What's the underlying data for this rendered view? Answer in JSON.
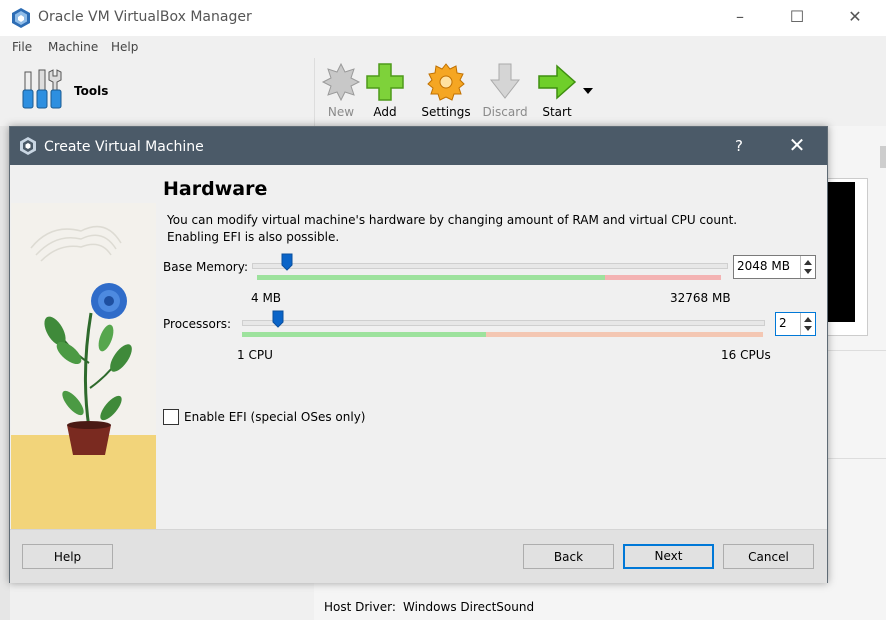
{
  "window": {
    "title": "Oracle VM VirtualBox Manager"
  },
  "menu": [
    "File",
    "Machine",
    "Help"
  ],
  "tools": {
    "label": "Tools"
  },
  "toolbar": {
    "buttons": [
      {
        "label": "New",
        "icon": "new-icon",
        "enabled": false
      },
      {
        "label": "Add",
        "icon": "add-icon",
        "enabled": true
      },
      {
        "label": "Settings",
        "icon": "settings-icon",
        "enabled": true
      },
      {
        "label": "Discard",
        "icon": "discard-icon",
        "enabled": false
      },
      {
        "label": "Start",
        "icon": "start-icon",
        "enabled": true
      }
    ]
  },
  "details": {
    "host_driver_label": "Host Driver:",
    "host_driver_value": "Windows DirectSound"
  },
  "dialog": {
    "title": "Create Virtual Machine",
    "help_glyph": "?",
    "heading": "Hardware",
    "description_line1": "You can modify virtual machine's hardware by changing amount of RAM and virtual CPU count.",
    "description_line2": "Enabling EFI is also possible.",
    "memory": {
      "label": "Base Memory:",
      "value": "2048 MB",
      "min_label": "4 MB",
      "max_label": "32768 MB",
      "min": 4,
      "max": 32768,
      "current": 2048
    },
    "processors": {
      "label": "Processors:",
      "value": "2",
      "min_label": "1 CPU",
      "max_label": "16 CPUs",
      "min": 1,
      "max": 16,
      "current": 2
    },
    "efi": {
      "label": "Enable EFI (special OSes only)",
      "checked": false
    },
    "buttons": {
      "help": "Help",
      "back": "Back",
      "next": "Next",
      "cancel": "Cancel"
    }
  },
  "colors": {
    "dialog_titlebar": "#4b5a68",
    "slider_green": "#9de29d",
    "slider_red": "#f4b3b3",
    "focus_blue": "#0078d7"
  }
}
